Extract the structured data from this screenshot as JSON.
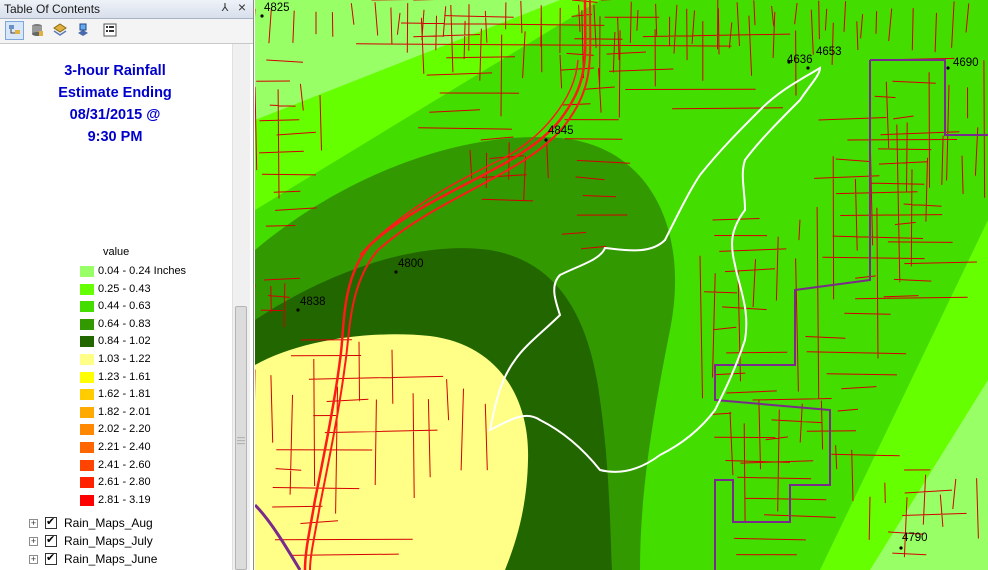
{
  "toc": {
    "title": "Table Of Contents",
    "pin_glyph": "⅄",
    "close_glyph": "×",
    "toolbar": [
      {
        "name": "list-by-drawing-order-icon"
      },
      {
        "name": "list-by-source-icon"
      },
      {
        "name": "list-by-visibility-icon"
      },
      {
        "name": "list-by-selection-icon"
      },
      {
        "name": "options-icon"
      }
    ],
    "map_title": [
      "3-hour Rainfall",
      "Estimate Ending",
      "08/31/2015 @",
      "9:30 PM"
    ],
    "legend_heading": "value",
    "legend": [
      {
        "label": "0.04 - 0.24 Inches",
        "color": "#99ff66"
      },
      {
        "label": "0.25 - 0.43",
        "color": "#66ff00"
      },
      {
        "label": "0.44 - 0.63",
        "color": "#44dd00"
      },
      {
        "label": "0.64 - 0.83",
        "color": "#339900"
      },
      {
        "label": "0.84 - 1.02",
        "color": "#226600"
      },
      {
        "label": "1.03 - 1.22",
        "color": "#ffff88"
      },
      {
        "label": "1.23 - 1.61",
        "color": "#ffff00"
      },
      {
        "label": "1.62 - 1.81",
        "color": "#ffcc00"
      },
      {
        "label": "1.82 - 2.01",
        "color": "#ffaa00"
      },
      {
        "label": "2.02 - 2.20",
        "color": "#ff8800"
      },
      {
        "label": "2.21 - 2.40",
        "color": "#ff6600"
      },
      {
        "label": "2.41 - 2.60",
        "color": "#ff4400"
      },
      {
        "label": "2.61 - 2.80",
        "color": "#ff2200"
      },
      {
        "label": "2.81 - 3.19",
        "color": "#ff0000"
      }
    ],
    "layers": [
      {
        "label": "Rain_Maps_Aug",
        "checked": true
      },
      {
        "label": "Rain_Maps_July",
        "checked": true
      },
      {
        "label": "Rain_Maps_June",
        "checked": true
      }
    ]
  },
  "map": {
    "gauges": [
      {
        "id": "4825"
      },
      {
        "id": "4653"
      },
      {
        "id": "4636"
      },
      {
        "id": "4690"
      },
      {
        "id": "4845"
      },
      {
        "id": "4800"
      },
      {
        "id": "4838"
      },
      {
        "id": "4790"
      }
    ],
    "colors": {
      "roads": "#d40000",
      "highway": "#ff1a1a",
      "watershed": "#ffffff",
      "boundary": "#7a2a8a"
    }
  }
}
